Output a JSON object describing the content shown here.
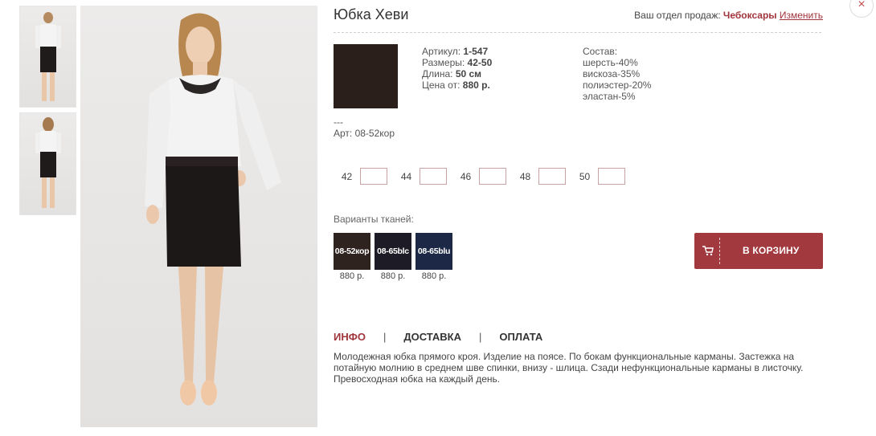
{
  "product": {
    "title": "Юбка Хеви"
  },
  "sales": {
    "label": "Ваш отдел продаж:",
    "city": "Чебоксары",
    "change_link": "Изменить"
  },
  "close": {
    "icon": "×"
  },
  "specs": {
    "article_label": "Артикул:",
    "article_value": "1-547",
    "sizes_label": "Размеры:",
    "sizes_value": "42-50",
    "length_label": "Длина:",
    "length_value": "50 см",
    "price_label": "Цена от:",
    "price_value": "880 р."
  },
  "composition": {
    "label": "Состав:",
    "items": [
      "шерсть-40%",
      "вискоза-35%",
      "полиэстер-20%",
      "эластан-5%"
    ]
  },
  "art": {
    "dashes": "---",
    "code": "Арт: 08-52кор"
  },
  "sizes": [
    "42",
    "44",
    "46",
    "48",
    "50"
  ],
  "variants": {
    "label": "Варианты тканей:",
    "items": [
      {
        "code": "08-52кор",
        "price": "880 р.",
        "color": "#2f2320"
      },
      {
        "code": "08-65blc",
        "price": "880 р.",
        "color": "#1d1c26"
      },
      {
        "code": "08-65blu",
        "price": "880 р.",
        "color": "#1d2846"
      }
    ]
  },
  "cart_button": {
    "label": "В КОРЗИНУ",
    "icon": "cart-icon"
  },
  "tabs": [
    "ИНФО",
    "ДОСТАВКА",
    "ОПЛАТА"
  ],
  "tab_separator": "|",
  "description": "Молодежная юбка прямого кроя. Изделие на поясе. По бокам функциональные карманы. Застежка на потайную молнию в среднем шве спинки, внизу - шлица. Сзади нефункциональные карманы в листочку. Превосходная юбка на каждый день.",
  "colors": {
    "accent": "#a0353b",
    "button": "#a2393e",
    "swatch_main": "#2b1f1c"
  }
}
